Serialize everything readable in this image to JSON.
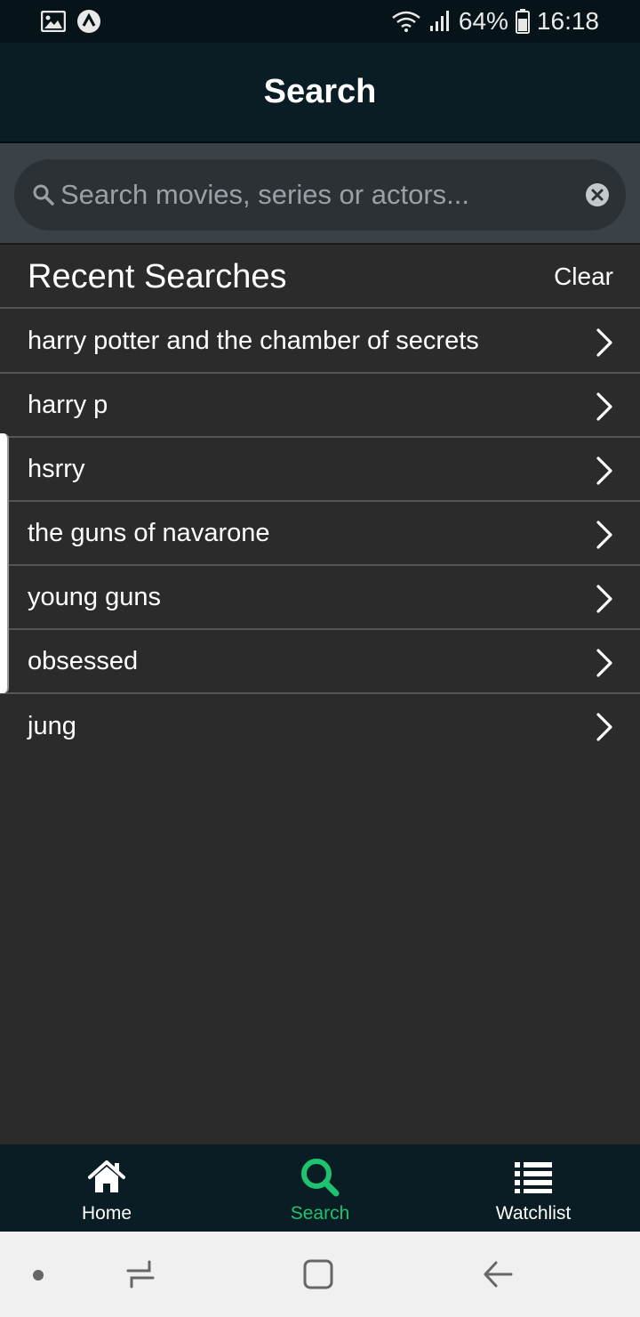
{
  "status_bar": {
    "battery_percent": "64%",
    "time": "16:18",
    "icons": [
      "gallery-icon",
      "app-notification-icon",
      "wifi-icon",
      "signal-icon",
      "battery-icon"
    ]
  },
  "header": {
    "title": "Search"
  },
  "search": {
    "placeholder": "Search movies, series or actors...",
    "value": ""
  },
  "recent": {
    "title": "Recent Searches",
    "clear_label": "Clear",
    "items": [
      {
        "label": "harry potter and the chamber of secrets"
      },
      {
        "label": "harry p"
      },
      {
        "label": "hsrry"
      },
      {
        "label": "the guns of navarone"
      },
      {
        "label": "young guns"
      },
      {
        "label": "obsessed"
      },
      {
        "label": "jung"
      }
    ]
  },
  "bottom_nav": {
    "active": "Search",
    "items": [
      {
        "label": "Home",
        "icon": "home-icon"
      },
      {
        "label": "Search",
        "icon": "search-icon"
      },
      {
        "label": "Watchlist",
        "icon": "list-icon"
      }
    ]
  },
  "colors": {
    "accent": "#1dc36e",
    "header_bg": "#0a1c24",
    "content_bg": "#2b2b2b",
    "search_area_bg": "#3b4247"
  }
}
